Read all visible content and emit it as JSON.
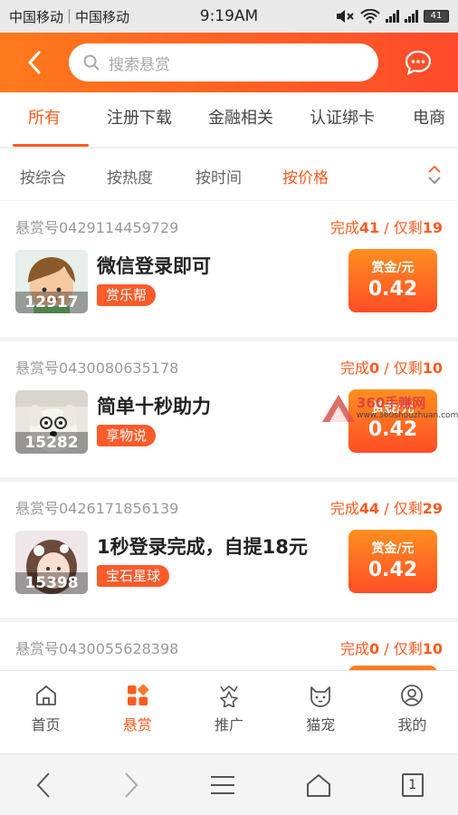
{
  "status_bar": {
    "carrier1": "中国移动",
    "carrier2": "中国移动",
    "time": "9:19AM",
    "battery": "41",
    "icons": [
      "mute-icon",
      "wifi-icon",
      "signal-icon",
      "signal-icon",
      "battery-icon"
    ]
  },
  "header": {
    "back_icon": "chevron-left-icon",
    "search_placeholder": "搜索悬赏",
    "message_icon": "chat-bubble-icon",
    "gradient_from": "#ff7a1c",
    "gradient_to": "#ff4a2b"
  },
  "categories": [
    {
      "label": "所有",
      "active": true
    },
    {
      "label": "注册下载",
      "active": false
    },
    {
      "label": "金融相关",
      "active": false
    },
    {
      "label": "认证绑卡",
      "active": false
    },
    {
      "label": "电商",
      "active": false
    }
  ],
  "sorts": [
    {
      "label": "按综合",
      "active": false
    },
    {
      "label": "按热度",
      "active": false
    },
    {
      "label": "按时间",
      "active": false
    },
    {
      "label": "按价格",
      "active": true
    }
  ],
  "tasks": [
    {
      "id": "悬赏号0429114459729",
      "done_label": "完成",
      "done": "41",
      "sep": " / ",
      "left_label": "仅剩",
      "left": "19",
      "count": "12917",
      "title": "微信登录即可",
      "tag": "赏乐帮",
      "reward_label": "赏金/元",
      "reward": "0.42"
    },
    {
      "id": "悬赏号0430080635178",
      "done_label": "完成",
      "done": "0",
      "sep": " / ",
      "left_label": "仅剩",
      "left": "10",
      "count": "15282",
      "title": "简单十秒助力",
      "tag": "享物说",
      "reward_label": "赏金/元",
      "reward": "0.42"
    },
    {
      "id": "悬赏号0426171856139",
      "done_label": "完成",
      "done": "44",
      "sep": " / ",
      "left_label": "仅剩",
      "left": "29",
      "count": "15398",
      "title": "1秒登录完成，自提18元",
      "tag": "宝石星球",
      "reward_label": "赏金/元",
      "reward": "0.42"
    },
    {
      "id": "悬赏号0430055628398",
      "done_label": "完成",
      "done": "0",
      "sep": " / ",
      "left_label": "仅剩",
      "left": "10",
      "count": "",
      "title": "",
      "tag": "",
      "reward_label": "",
      "reward": ""
    }
  ],
  "watermark": {
    "main": "360手赚网",
    "sub": "www.360shouzhuan.com"
  },
  "tabbar": [
    {
      "label": "首页",
      "icon": "home-icon",
      "active": false
    },
    {
      "label": "悬赏",
      "icon": "reward-grid-icon",
      "active": true
    },
    {
      "label": "推广",
      "icon": "crown-star-icon",
      "active": false
    },
    {
      "label": "猫宠",
      "icon": "cat-icon",
      "active": false
    },
    {
      "label": "我的",
      "icon": "profile-icon",
      "active": false
    }
  ],
  "sysnav": {
    "back_icon": "nav-back-icon",
    "forward_icon": "nav-forward-icon",
    "menu_icon": "menu-icon",
    "home_icon": "nav-home-icon",
    "tabs_count": "1"
  },
  "accent_color": "#ff5a1f"
}
